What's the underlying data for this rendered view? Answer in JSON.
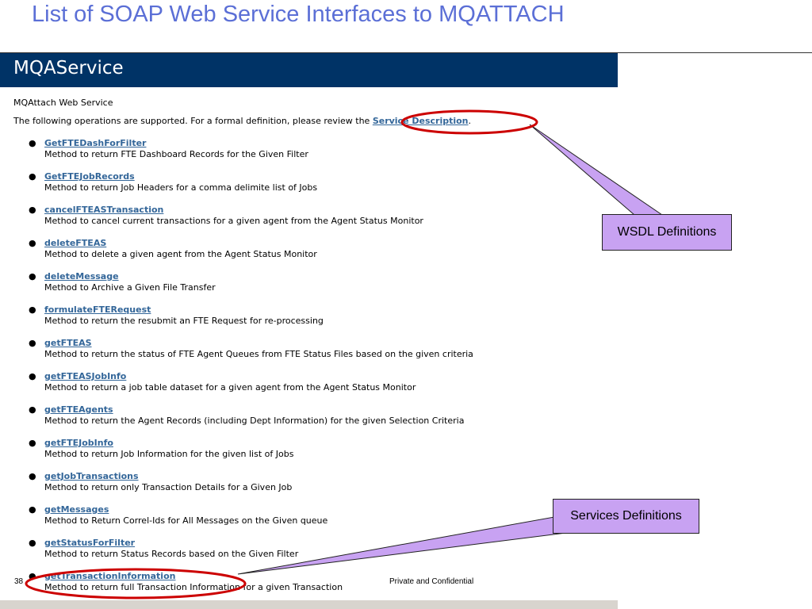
{
  "slide": {
    "title": "List of SOAP Web Service Interfaces to MQATTACH",
    "page_number": "38",
    "footer_text": "Private and Confidential"
  },
  "service": {
    "name": "MQAService",
    "subtitle": "MQAttach Web Service",
    "intro_text": "The following operations are supported. For a formal definition, please review the ",
    "intro_link": "Service Description",
    "intro_end": "."
  },
  "operations": [
    {
      "name": "GetFTEDashForFilter",
      "desc": "Method to return FTE Dashboard Records for the Given Filter"
    },
    {
      "name": "GetFTEJobRecords",
      "desc": "Method to return Job Headers for a comma delimite list of Jobs"
    },
    {
      "name": "cancelFTEASTransaction",
      "desc": "Method to cancel current transactions for a given agent from the Agent Status Monitor"
    },
    {
      "name": "deleteFTEAS",
      "desc": "Method to delete a given agent from the Agent Status Monitor"
    },
    {
      "name": "deleteMessage",
      "desc": "Method to Archive a Given File Transfer"
    },
    {
      "name": "formulateFTERequest",
      "desc": "Method to return the resubmit an FTE Request for re-processing"
    },
    {
      "name": "getFTEAS",
      "desc": "Method to return the status of FTE Agent Queues from FTE Status Files based on the given criteria"
    },
    {
      "name": "getFTEASJobInfo",
      "desc": "Method to return a job table dataset for a given agent from the Agent Status Monitor"
    },
    {
      "name": "getFTEAgents",
      "desc": "Method to return the Agent Records (including Dept Information) for the given Selection Criteria"
    },
    {
      "name": "getFTEJobInfo",
      "desc": "Method to return Job Information for the given list of Jobs"
    },
    {
      "name": "getJobTransactions",
      "desc": "Method to return only Transaction Details for a Given Job"
    },
    {
      "name": "getMessages",
      "desc": "Method to Return Correl-Ids for All Messages on the Given queue"
    },
    {
      "name": "getStatusForFilter",
      "desc": "Method to return Status Records based on the Given Filter"
    },
    {
      "name": "getTransactionInformation",
      "desc": "Method to return full Transaction Information for a given Transaction"
    }
  ],
  "callouts": {
    "wsdl": "WSDL Definitions",
    "services": "Services Definitions"
  },
  "colors": {
    "header_bar": "#003366",
    "link": "#336699",
    "callout_fill": "#c8a2f2",
    "highlight_ellipse": "#cc0000",
    "title": "#5b6fd6"
  }
}
